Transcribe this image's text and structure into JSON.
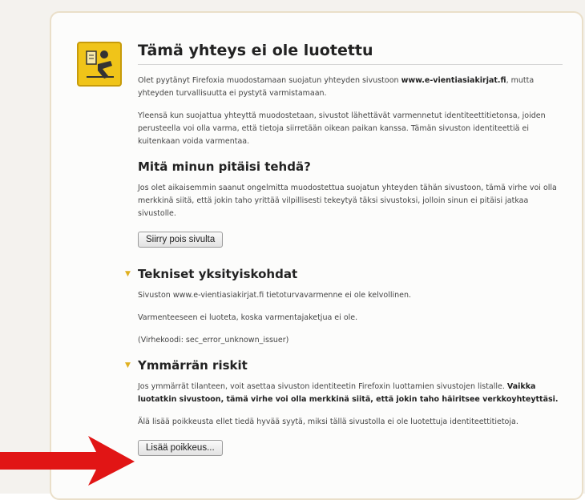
{
  "header": {
    "title": "Tämä yhteys ei ole luotettu"
  },
  "intro": {
    "p1_before": "Olet pyytänyt Firefoxia muodostamaan suojatun yhteyden sivustoon ",
    "p1_site": "www.e-vientiasiakirjat.fi",
    "p1_after": ", mutta yhteyden turvallisuutta ei pystytä varmistamaan.",
    "p2": "Yleensä kun suojattua yhteyttä muodostetaan, sivustot lähettävät varmennetut identiteettitietonsa, joiden perusteella voi olla varma, että tietoja siirretään oikean paikan kanssa. Tämän sivuston identiteettiä ei kuitenkaan voida varmentaa."
  },
  "what_to_do": {
    "heading": "Mitä minun pitäisi tehdä?",
    "text": "Jos olet aikaisemmin saanut ongelmitta muodostettua suojatun yhteyden tähän sivustoon, tämä virhe voi olla merkkinä siitä, että jokin taho yrittää vilpillisesti tekeytyä täksi sivustoksi, jolloin sinun ei pitäisi jatkaa sivustolle.",
    "button": "Siirry pois sivulta"
  },
  "technical": {
    "heading": "Tekniset yksityiskohdat",
    "line1": "Sivuston www.e-vientiasiakirjat.fi tietoturvavarmenne ei ole kelvollinen.",
    "line2": "Varmenteeseen ei luoteta, koska varmentajaketjua ei ole.",
    "line3": "(Virhekoodi: sec_error_unknown_issuer)"
  },
  "risks": {
    "heading": "Ymmärrän riskit",
    "text_plain": "Jos ymmärrät tilanteen, voit asettaa sivuston identiteetin Firefoxin luottamien sivustojen listalle. ",
    "text_bold": "Vaikka luotatkin sivustoon, tämä virhe voi olla merkkinä siitä, että jokin taho häiritsee verkkoyhteyttäsi.",
    "warning": "Älä lisää poikkeusta ellet tiedä hyvää syytä, miksi tällä sivustolla ei ole luotettuja identiteettitietoja.",
    "button": "Lisää poikkeus..."
  },
  "colors": {
    "shield_yellow": "#f0c419",
    "arrow_red": "#e11515",
    "expander_triangle": "#e0b020"
  },
  "icons": {
    "shield": "untrusted-connection-icon",
    "expander": "expander-triangle-icon",
    "annotation": "red-arrow-annotation"
  }
}
